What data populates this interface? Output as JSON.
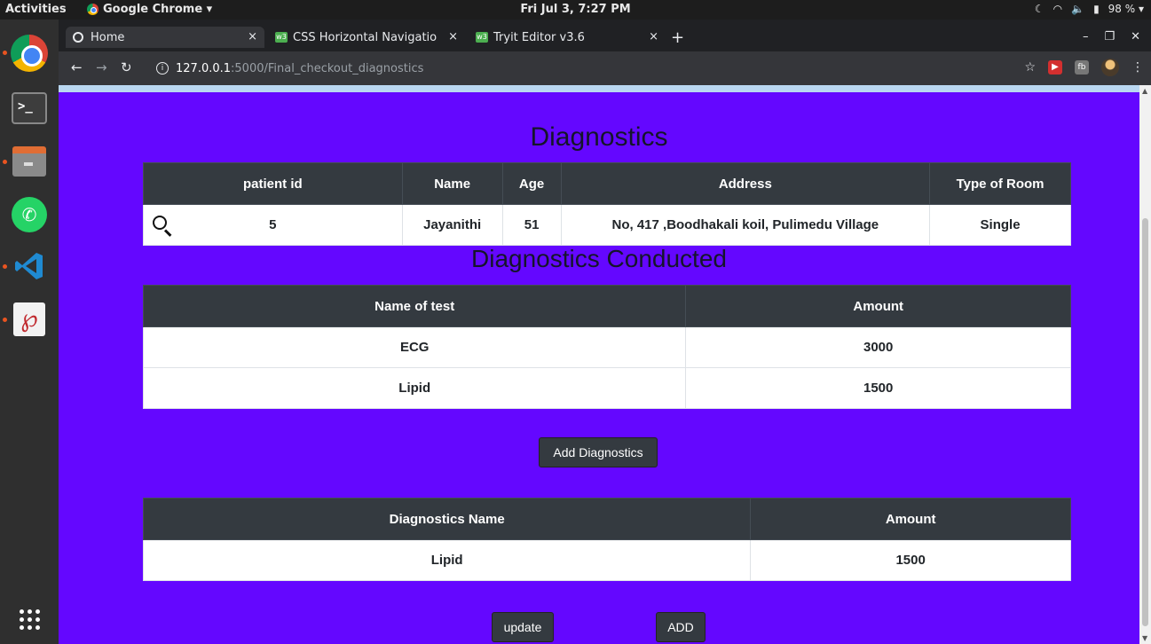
{
  "system": {
    "activities": "Activities",
    "app_name": "Google Chrome ▾",
    "clock": "Fri Jul  3,  7:27 PM",
    "battery": "98 % ▾"
  },
  "browser": {
    "tabs": [
      {
        "label": "Home",
        "close": "×"
      },
      {
        "label": "CSS Horizontal Navigatio",
        "close": "×"
      },
      {
        "label": "Tryit Editor v3.6",
        "close": "×"
      }
    ],
    "new_tab": "+",
    "url_host": "127.0.0.1",
    "url_path": ":5000/Final_checkout_diagnostics"
  },
  "page": {
    "title": "Diagnostics",
    "patient_table": {
      "headers": [
        "patient id",
        "Name",
        "Age",
        "Address",
        "Type of Room"
      ],
      "row": [
        "5",
        "Jayanithi",
        "51",
        "No, 417 ,Boodhakali koil, Pulimedu Village",
        "Single"
      ]
    },
    "conducted_title": "Diagnostics Conducted",
    "conducted_table": {
      "headers": [
        "Name of test",
        "Amount"
      ],
      "rows": [
        [
          "ECG",
          "3000"
        ],
        [
          "Lipid",
          "1500"
        ]
      ]
    },
    "add_diagnostics_label": "Add Diagnostics",
    "selected_table": {
      "headers": [
        "Diagnostics Name",
        "Amount"
      ],
      "rows": [
        [
          "Lipid",
          "1500"
        ]
      ]
    },
    "update_label": "update",
    "add_label": "ADD"
  }
}
